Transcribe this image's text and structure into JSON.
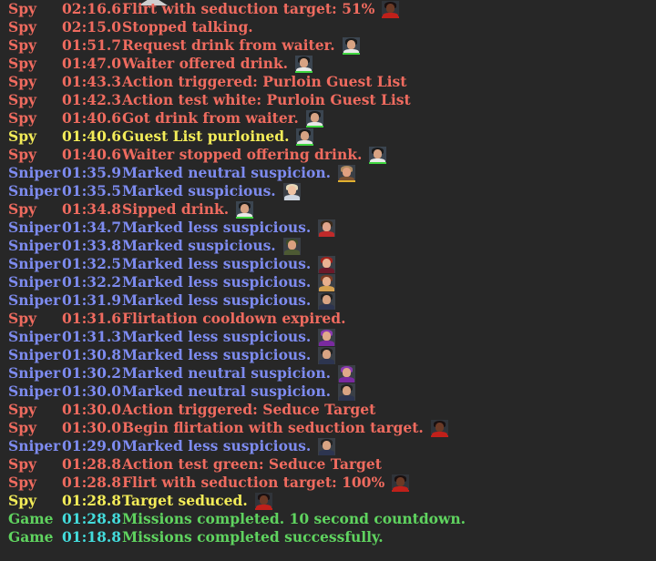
{
  "colors": {
    "spy": "#ef6b5f",
    "spy_highlight": "#f3ec58",
    "sniper": "#7d8bef",
    "game": "#5fd35f",
    "game_time": "#43dcdc",
    "background": "#272727"
  },
  "log": [
    {
      "actor": "Spy",
      "time": "02:16.6",
      "message": "Flirt with seduction target: 51%",
      "cls": "spy",
      "portrait": "seduction-target-portrait-icon"
    },
    {
      "actor": "Spy",
      "time": "02:15.0",
      "message": "Stopped talking.",
      "cls": "spy",
      "portrait": ""
    },
    {
      "actor": "Spy",
      "time": "01:51.7",
      "message": "Request drink from waiter.",
      "cls": "spy",
      "portrait": "waiter-portrait-icon"
    },
    {
      "actor": "Spy",
      "time": "01:47.0",
      "message": "Waiter offered drink.",
      "cls": "spy",
      "portrait": "waiter-portrait-icon"
    },
    {
      "actor": "Spy",
      "time": "01:43.3",
      "message": "Action triggered: Purloin Guest List",
      "cls": "spy",
      "portrait": ""
    },
    {
      "actor": "Spy",
      "time": "01:42.3",
      "message": "Action test white: Purloin Guest List",
      "cls": "spy",
      "portrait": ""
    },
    {
      "actor": "Spy",
      "time": "01:40.6",
      "message": "Got drink from waiter.",
      "cls": "spy",
      "portrait": "waiter-portrait-icon"
    },
    {
      "actor": "Spy",
      "time": "01:40.6",
      "message": "Guest List purloined.",
      "cls": "spyhi",
      "portrait": "waiter-portrait-icon"
    },
    {
      "actor": "Spy",
      "time": "01:40.6",
      "message": "Waiter stopped offering drink.",
      "cls": "spy",
      "portrait": "waiter-portrait-icon"
    },
    {
      "actor": "Sniper",
      "time": "01:35.9",
      "message": "Marked neutral suspicion.",
      "cls": "sniper",
      "portrait": "cowboy-guest-portrait-icon"
    },
    {
      "actor": "Sniper",
      "time": "01:35.5",
      "message": "Marked suspicious.",
      "cls": "sniper",
      "portrait": "blonde-guest-portrait-icon"
    },
    {
      "actor": "Spy",
      "time": "01:34.8",
      "message": "Sipped drink.",
      "cls": "spy",
      "portrait": "waiter-portrait-icon"
    },
    {
      "actor": "Sniper",
      "time": "01:34.7",
      "message": "Marked less suspicious.",
      "cls": "sniper",
      "portrait": "red-shirt-guest-portrait-icon"
    },
    {
      "actor": "Sniper",
      "time": "01:33.8",
      "message": "Marked suspicious.",
      "cls": "sniper",
      "portrait": "military-guest-portrait-icon"
    },
    {
      "actor": "Sniper",
      "time": "01:32.5",
      "message": "Marked less suspicious.",
      "cls": "sniper",
      "portrait": "redhead-guest-portrait-icon"
    },
    {
      "actor": "Sniper",
      "time": "01:32.2",
      "message": "Marked less suspicious.",
      "cls": "sniper",
      "portrait": "auburn-guest-portrait-icon"
    },
    {
      "actor": "Sniper",
      "time": "01:31.9",
      "message": "Marked less suspicious.",
      "cls": "sniper",
      "portrait": "suit-guest-portrait-icon"
    },
    {
      "actor": "Spy",
      "time": "01:31.6",
      "message": "Flirtation cooldown expired.",
      "cls": "spy",
      "portrait": ""
    },
    {
      "actor": "Sniper",
      "time": "01:31.3",
      "message": "Marked less suspicious.",
      "cls": "sniper",
      "portrait": "purple-hat-guest-portrait-icon"
    },
    {
      "actor": "Sniper",
      "time": "01:30.8",
      "message": "Marked less suspicious.",
      "cls": "sniper",
      "portrait": "suit-guest-portrait-icon"
    },
    {
      "actor": "Sniper",
      "time": "01:30.2",
      "message": "Marked neutral suspicion.",
      "cls": "sniper",
      "portrait": "purple-hat-guest-portrait-icon"
    },
    {
      "actor": "Sniper",
      "time": "01:30.0",
      "message": "Marked neutral suspicion.",
      "cls": "sniper",
      "portrait": "suit-guest-portrait-icon"
    },
    {
      "actor": "Spy",
      "time": "01:30.0",
      "message": "Action triggered: Seduce Target",
      "cls": "spy",
      "portrait": ""
    },
    {
      "actor": "Spy",
      "time": "01:30.0",
      "message": "Begin flirtation with seduction target.",
      "cls": "spy",
      "portrait": "seduction-target-portrait-icon"
    },
    {
      "actor": "Sniper",
      "time": "01:29.0",
      "message": "Marked less suspicious.",
      "cls": "sniper",
      "portrait": "suit-guest-portrait-icon"
    },
    {
      "actor": "Spy",
      "time": "01:28.8",
      "message": "Action test green: Seduce Target",
      "cls": "spy",
      "portrait": ""
    },
    {
      "actor": "Spy",
      "time": "01:28.8",
      "message": "Flirt with seduction target: 100%",
      "cls": "spy",
      "portrait": "seduction-target-portrait-icon"
    },
    {
      "actor": "Spy",
      "time": "01:28.8",
      "message": "Target seduced.",
      "cls": "spyhi",
      "portrait": "seduction-target-portrait-icon"
    },
    {
      "actor": "Game",
      "time": "01:28.8",
      "message": "Missions completed. 10 second countdown.",
      "cls": "game",
      "portrait": ""
    },
    {
      "actor": "Game",
      "time": "01:18.8",
      "message": "Missions completed successfully.",
      "cls": "game",
      "portrait": ""
    }
  ]
}
